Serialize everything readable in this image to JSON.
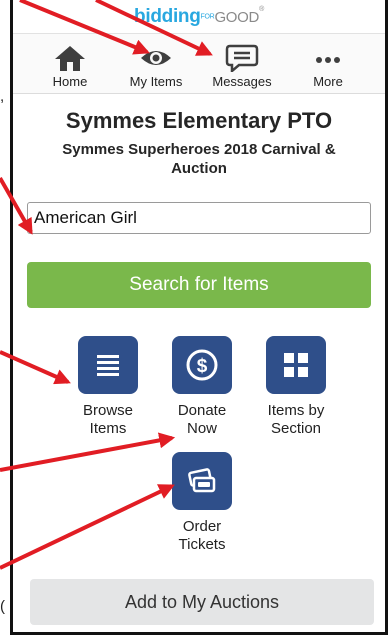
{
  "side_fragments": [
    ",",
    "("
  ],
  "brand": {
    "part1": "bidding",
    "part2": "FOR",
    "part3": "GOOD",
    "part4": "®"
  },
  "nav": {
    "items": [
      {
        "label": "Home",
        "icon": "home-icon"
      },
      {
        "label": "My Items",
        "icon": "eye-icon"
      },
      {
        "label": "Messages",
        "icon": "chat-icon"
      },
      {
        "label": "More",
        "icon": "dots-icon"
      }
    ]
  },
  "org": {
    "title": "Symmes Elementary PTO",
    "subtitle": "Symmes Superheroes 2018 Carnival & Auction"
  },
  "search": {
    "value": "American Girl",
    "button_label": "Search for Items"
  },
  "tiles": [
    {
      "label": "Browse Items",
      "icon": "list-icon"
    },
    {
      "label": "Donate Now",
      "icon": "dollar-coin-icon"
    },
    {
      "label": "Items by Section",
      "icon": "grid-icon"
    },
    {
      "label": "Order Tickets",
      "icon": "tickets-icon"
    }
  ],
  "add_button_label": "Add to My Auctions",
  "colors": {
    "accent_green": "#7ab84b",
    "tile_blue": "#2f4f8a",
    "annotation_red": "#e11d24",
    "brand_blue": "#29a8e0"
  }
}
